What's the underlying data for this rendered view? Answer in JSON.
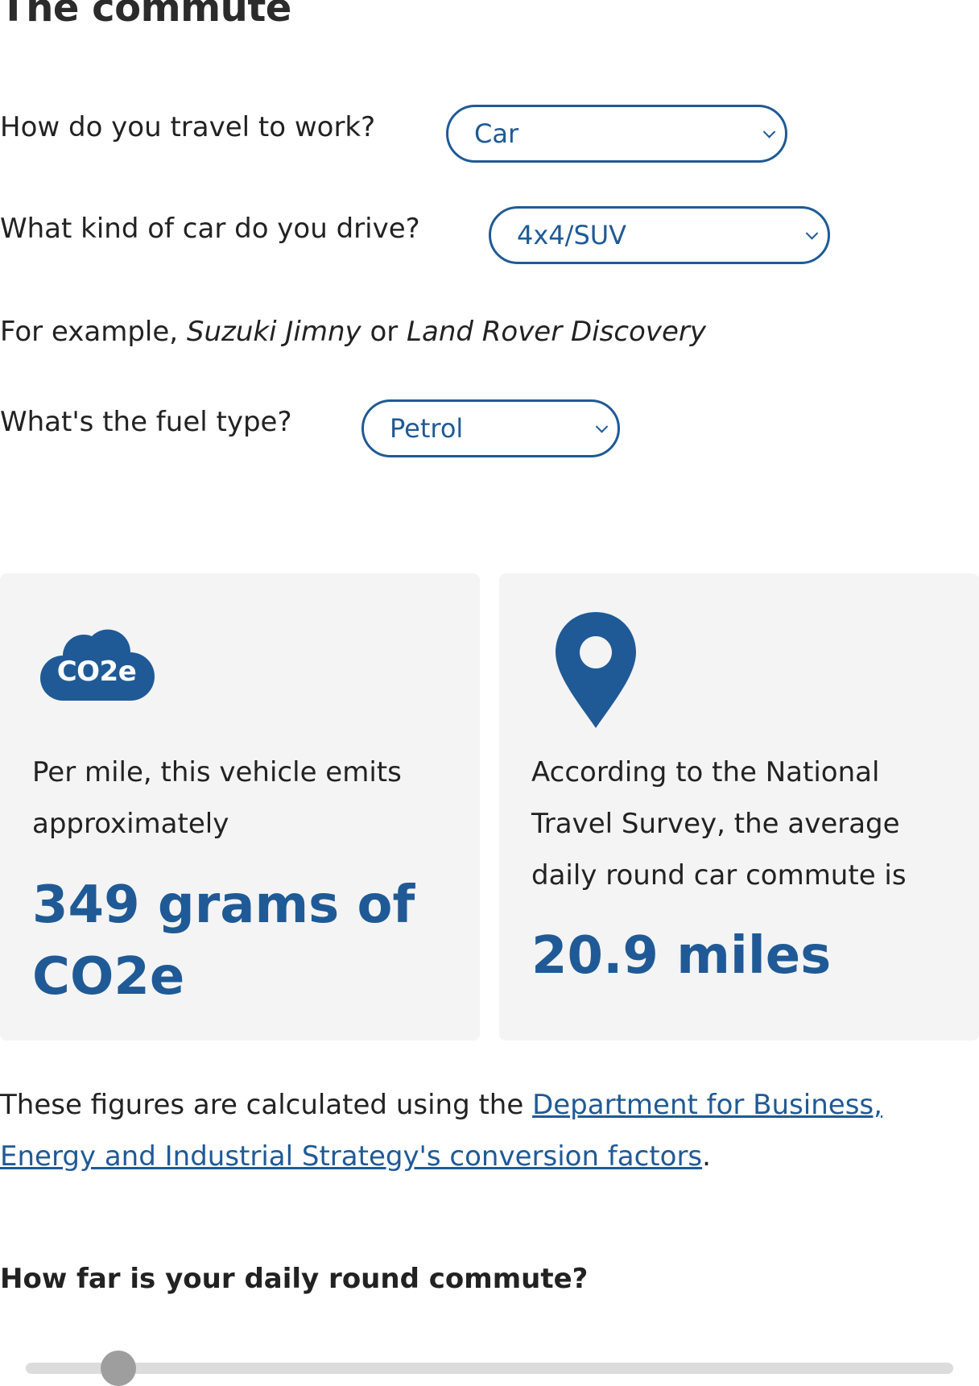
{
  "page": {
    "title": "The commute"
  },
  "questions": {
    "travel": {
      "label": "How do you travel to work?",
      "value": "Car"
    },
    "car_kind": {
      "label": "What kind of car do you drive?",
      "value": "4x4/SUV"
    },
    "example": {
      "prefix": "For example,",
      "example_1": "Suzuki Jimny",
      "joiner": "or",
      "example_2": "Land Rover Discovery"
    },
    "fuel": {
      "label": "What's the fuel type?",
      "value": "Petrol"
    }
  },
  "cards": {
    "emissions": {
      "icon": "co2e-cloud-icon",
      "icon_text": "CO2e",
      "body": "Per mile, this vehicle emits approximately",
      "value": "349 grams of CO2e"
    },
    "distance": {
      "icon": "map-pin-icon",
      "body": "According to the National Travel Survey, the average daily round car commute is",
      "value": "20.9 miles"
    }
  },
  "footnote": {
    "prefix": "These figures are calculated using the ",
    "link_text": "Department for Business, Energy and Industrial Strategy's conversion factors",
    "suffix": "."
  },
  "slider": {
    "question": "How far is your daily round commute?",
    "value_fraction": 0.1
  },
  "colors": {
    "accent": "#1f5a96",
    "card_bg": "#f4f4f4",
    "slider_track": "#dcdcdc",
    "slider_thumb": "#9e9e9e"
  }
}
